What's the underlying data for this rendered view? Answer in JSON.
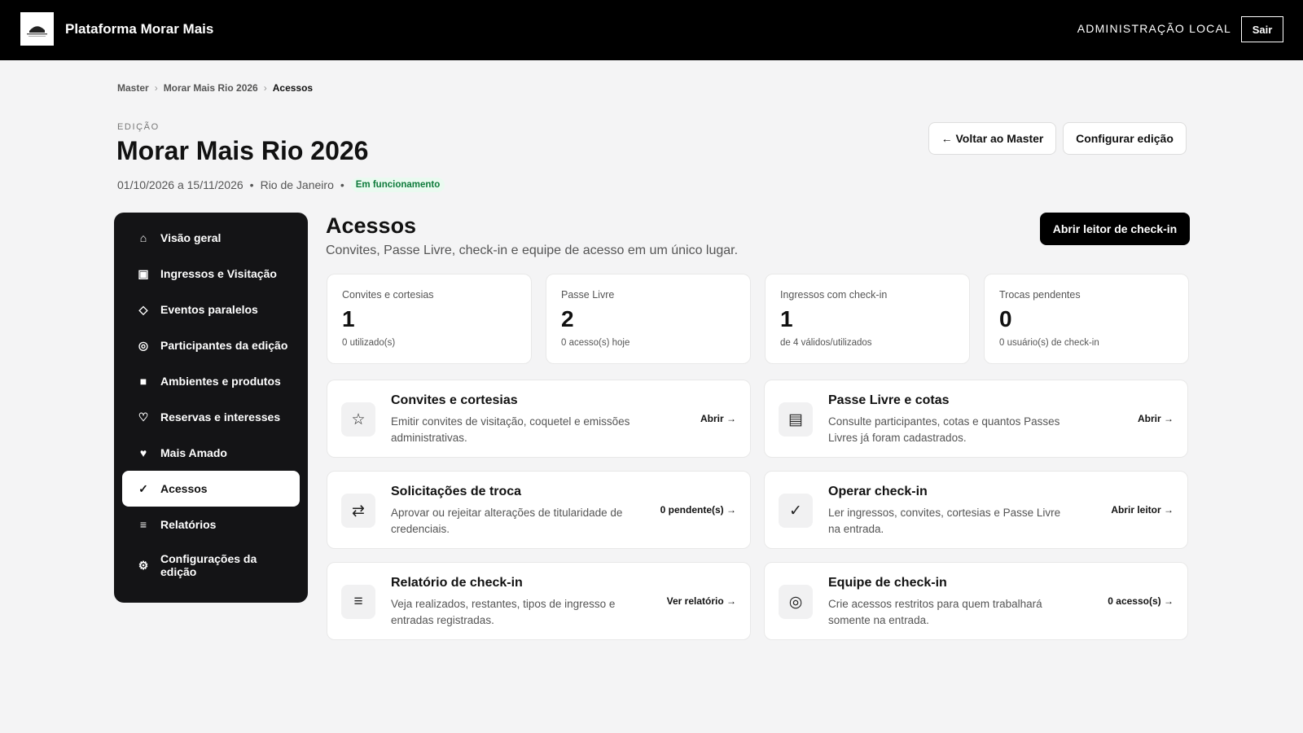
{
  "header": {
    "brand": "Plataforma Morar Mais",
    "admin_label": "ADMINISTRAÇÃO LOCAL",
    "logout": "Sair"
  },
  "breadcrumb": [
    "Master",
    "Morar Mais Rio 2026",
    "Acessos"
  ],
  "edition": {
    "kicker": "EDIÇÃO",
    "title": "Morar Mais Rio 2026",
    "dates": "01/10/2026 a 15/11/2026",
    "city": "Rio de Janeiro",
    "status": "Em funcionamento",
    "back_button": "← Voltar ao Master",
    "config_button": "Configurar edição"
  },
  "sidebar": {
    "items": [
      {
        "label": "Visão geral",
        "icon": "⌂"
      },
      {
        "label": "Ingressos e Visitação",
        "icon": "▣"
      },
      {
        "label": "Eventos paralelos",
        "icon": "◇"
      },
      {
        "label": "Participantes da edição",
        "icon": "◎"
      },
      {
        "label": "Ambientes e produtos",
        "icon": "■"
      },
      {
        "label": "Reservas e interesses",
        "icon": "♡"
      },
      {
        "label": "Mais Amado",
        "icon": "♥"
      },
      {
        "label": "Acessos",
        "icon": "✓"
      },
      {
        "label": "Relatórios",
        "icon": "≡"
      },
      {
        "label": "Configurações da edição",
        "icon": "⚙"
      }
    ]
  },
  "main": {
    "title": "Acessos",
    "subtitle": "Convites, Passe Livre, check-in e equipe de acesso em um único lugar.",
    "primary_button": "Abrir leitor de check-in",
    "stats": [
      {
        "label": "Convites e cortesias",
        "value": "1",
        "sub": "0 utilizado(s)"
      },
      {
        "label": "Passe Livre",
        "value": "2",
        "sub": "0 acesso(s) hoje"
      },
      {
        "label": "Ingressos com check-in",
        "value": "1",
        "sub": "de 4 válidos/utilizados"
      },
      {
        "label": "Trocas pendentes",
        "value": "0",
        "sub": "0 usuário(s) de check-in"
      }
    ],
    "cards": [
      {
        "title": "Convites e cortesias",
        "desc": "Emitir convites de visitação, coquetel e emissões administrativas.",
        "link": "Abrir →",
        "icon": "☆"
      },
      {
        "title": "Passe Livre e cotas",
        "desc": "Consulte participantes, cotas e quantos Passes Livres já foram cadastrados.",
        "link": "Abrir →",
        "icon": "▤"
      },
      {
        "title": "Solicitações de troca",
        "desc": "Aprovar ou rejeitar alterações de titularidade de credenciais.",
        "link": "0 pendente(s) →",
        "icon": "⇄"
      },
      {
        "title": "Operar check-in",
        "desc": "Ler ingressos, convites, cortesias e Passe Livre na entrada.",
        "link": "Abrir leitor →",
        "icon": "✓"
      },
      {
        "title": "Relatório de check-in",
        "desc": "Veja realizados, restantes, tipos de ingresso e entradas registradas.",
        "link": "Ver relatório →",
        "icon": "≡"
      },
      {
        "title": "Equipe de check-in",
        "desc": "Crie acessos restritos para quem trabalhará somente na entrada.",
        "link": "0 acesso(s) →",
        "icon": "◎"
      }
    ]
  }
}
